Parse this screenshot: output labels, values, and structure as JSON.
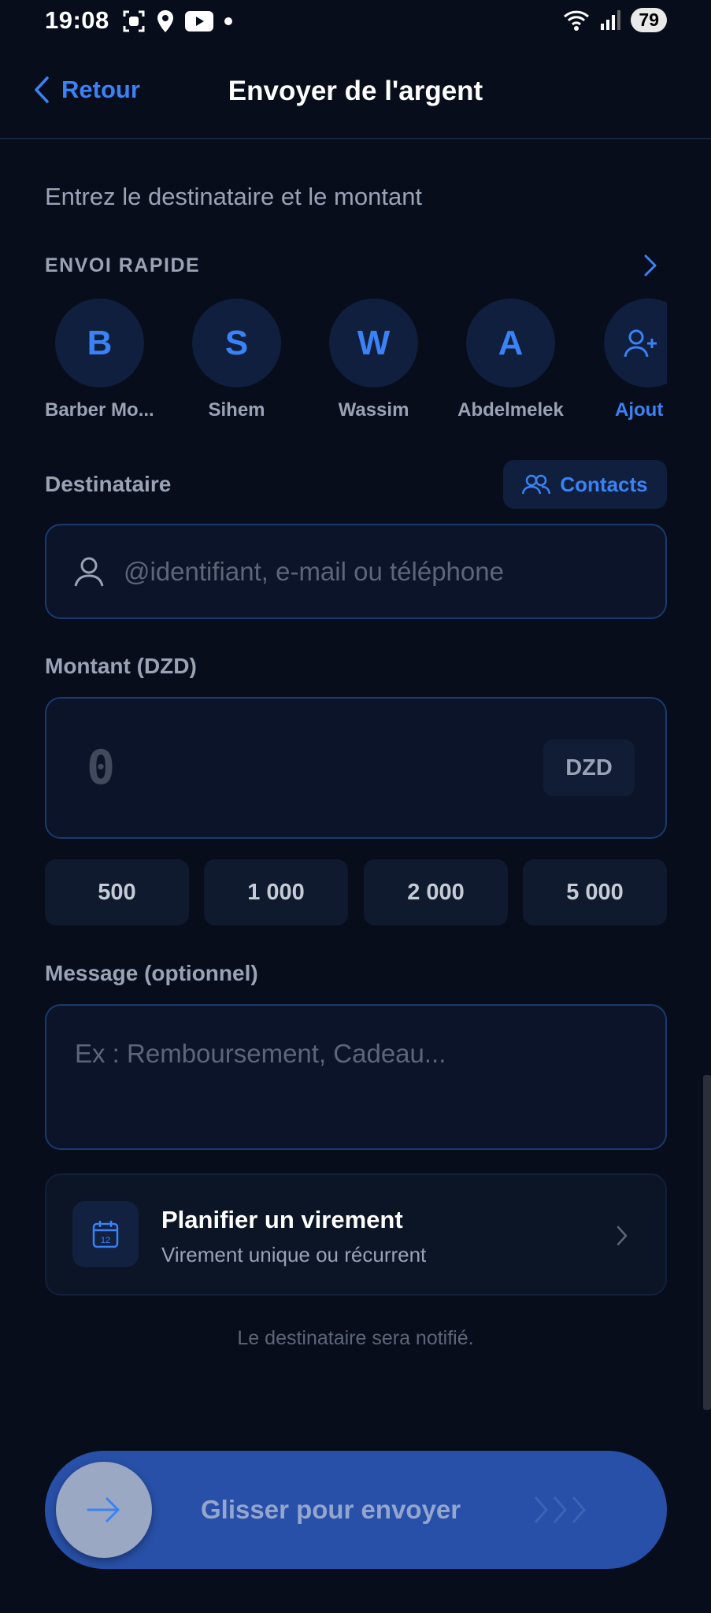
{
  "status_bar": {
    "time": "19:08",
    "battery": "79",
    "icons": [
      "screen-record-icon",
      "location-icon",
      "youtube-icon",
      "dot-icon",
      "wifi-icon",
      "signal-icon"
    ]
  },
  "header": {
    "back_label": "Retour",
    "title": "Envoyer de l'argent"
  },
  "subtitle": "Entrez le destinataire et le montant",
  "quick_send": {
    "label": "ENVOI RAPIDE",
    "contacts": [
      {
        "initial": "B",
        "name": "Barber Mo..."
      },
      {
        "initial": "S",
        "name": "Sihem"
      },
      {
        "initial": "W",
        "name": "Wassim"
      },
      {
        "initial": "A",
        "name": "Abdelmelek"
      }
    ],
    "add_label": "Ajout"
  },
  "recipient": {
    "label": "Destinataire",
    "contacts_button": "Contacts",
    "placeholder": "@identifiant, e-mail ou téléphone"
  },
  "amount": {
    "label": "Montant (DZD)",
    "value": "0",
    "currency": "DZD",
    "presets": [
      "500",
      "1 000",
      "2 000",
      "5 000"
    ]
  },
  "message": {
    "label": "Message (optionnel)",
    "placeholder": "Ex : Remboursement, Cadeau..."
  },
  "schedule": {
    "title": "Planifier un virement",
    "subtitle": "Virement unique ou récurrent",
    "calendar_day": "12"
  },
  "notice": "Le destinataire sera notifié.",
  "slider": {
    "label": "Glisser pour envoyer"
  },
  "colors": {
    "background": "#070d1b",
    "accent": "#3b82f6",
    "slider": "#2850a8",
    "muted_text": "#9aa3b5"
  }
}
